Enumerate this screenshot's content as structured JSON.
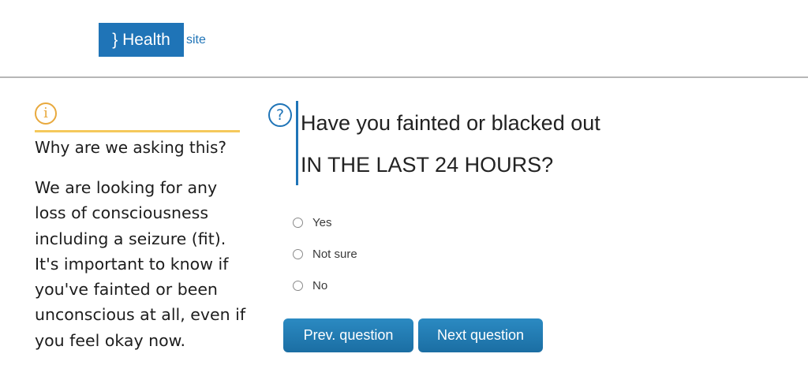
{
  "header": {
    "logo_text": "} Health",
    "logo_suffix": "site"
  },
  "sidebar": {
    "info_icon": "i",
    "title": "Why are we asking this?",
    "body": "We are looking for any loss of consciousness including a seizure (fit). It's important to know if you've fainted or been unconscious at all, even if you feel okay now."
  },
  "question": {
    "help_icon": "?",
    "line1": "Have you fainted or blacked out",
    "line2": "IN THE LAST 24 HOURS?"
  },
  "options": [
    {
      "label": "Yes",
      "selected": false
    },
    {
      "label": "Not sure",
      "selected": false
    },
    {
      "label": "No",
      "selected": false
    }
  ],
  "buttons": {
    "prev_label": "Prev. question",
    "next_label": "Next question"
  },
  "colors": {
    "brand_blue": "#1f74b7",
    "info_orange": "#e8a93d",
    "info_rule_yellow": "#f5c95c",
    "button_blue": "#1f78b0"
  }
}
